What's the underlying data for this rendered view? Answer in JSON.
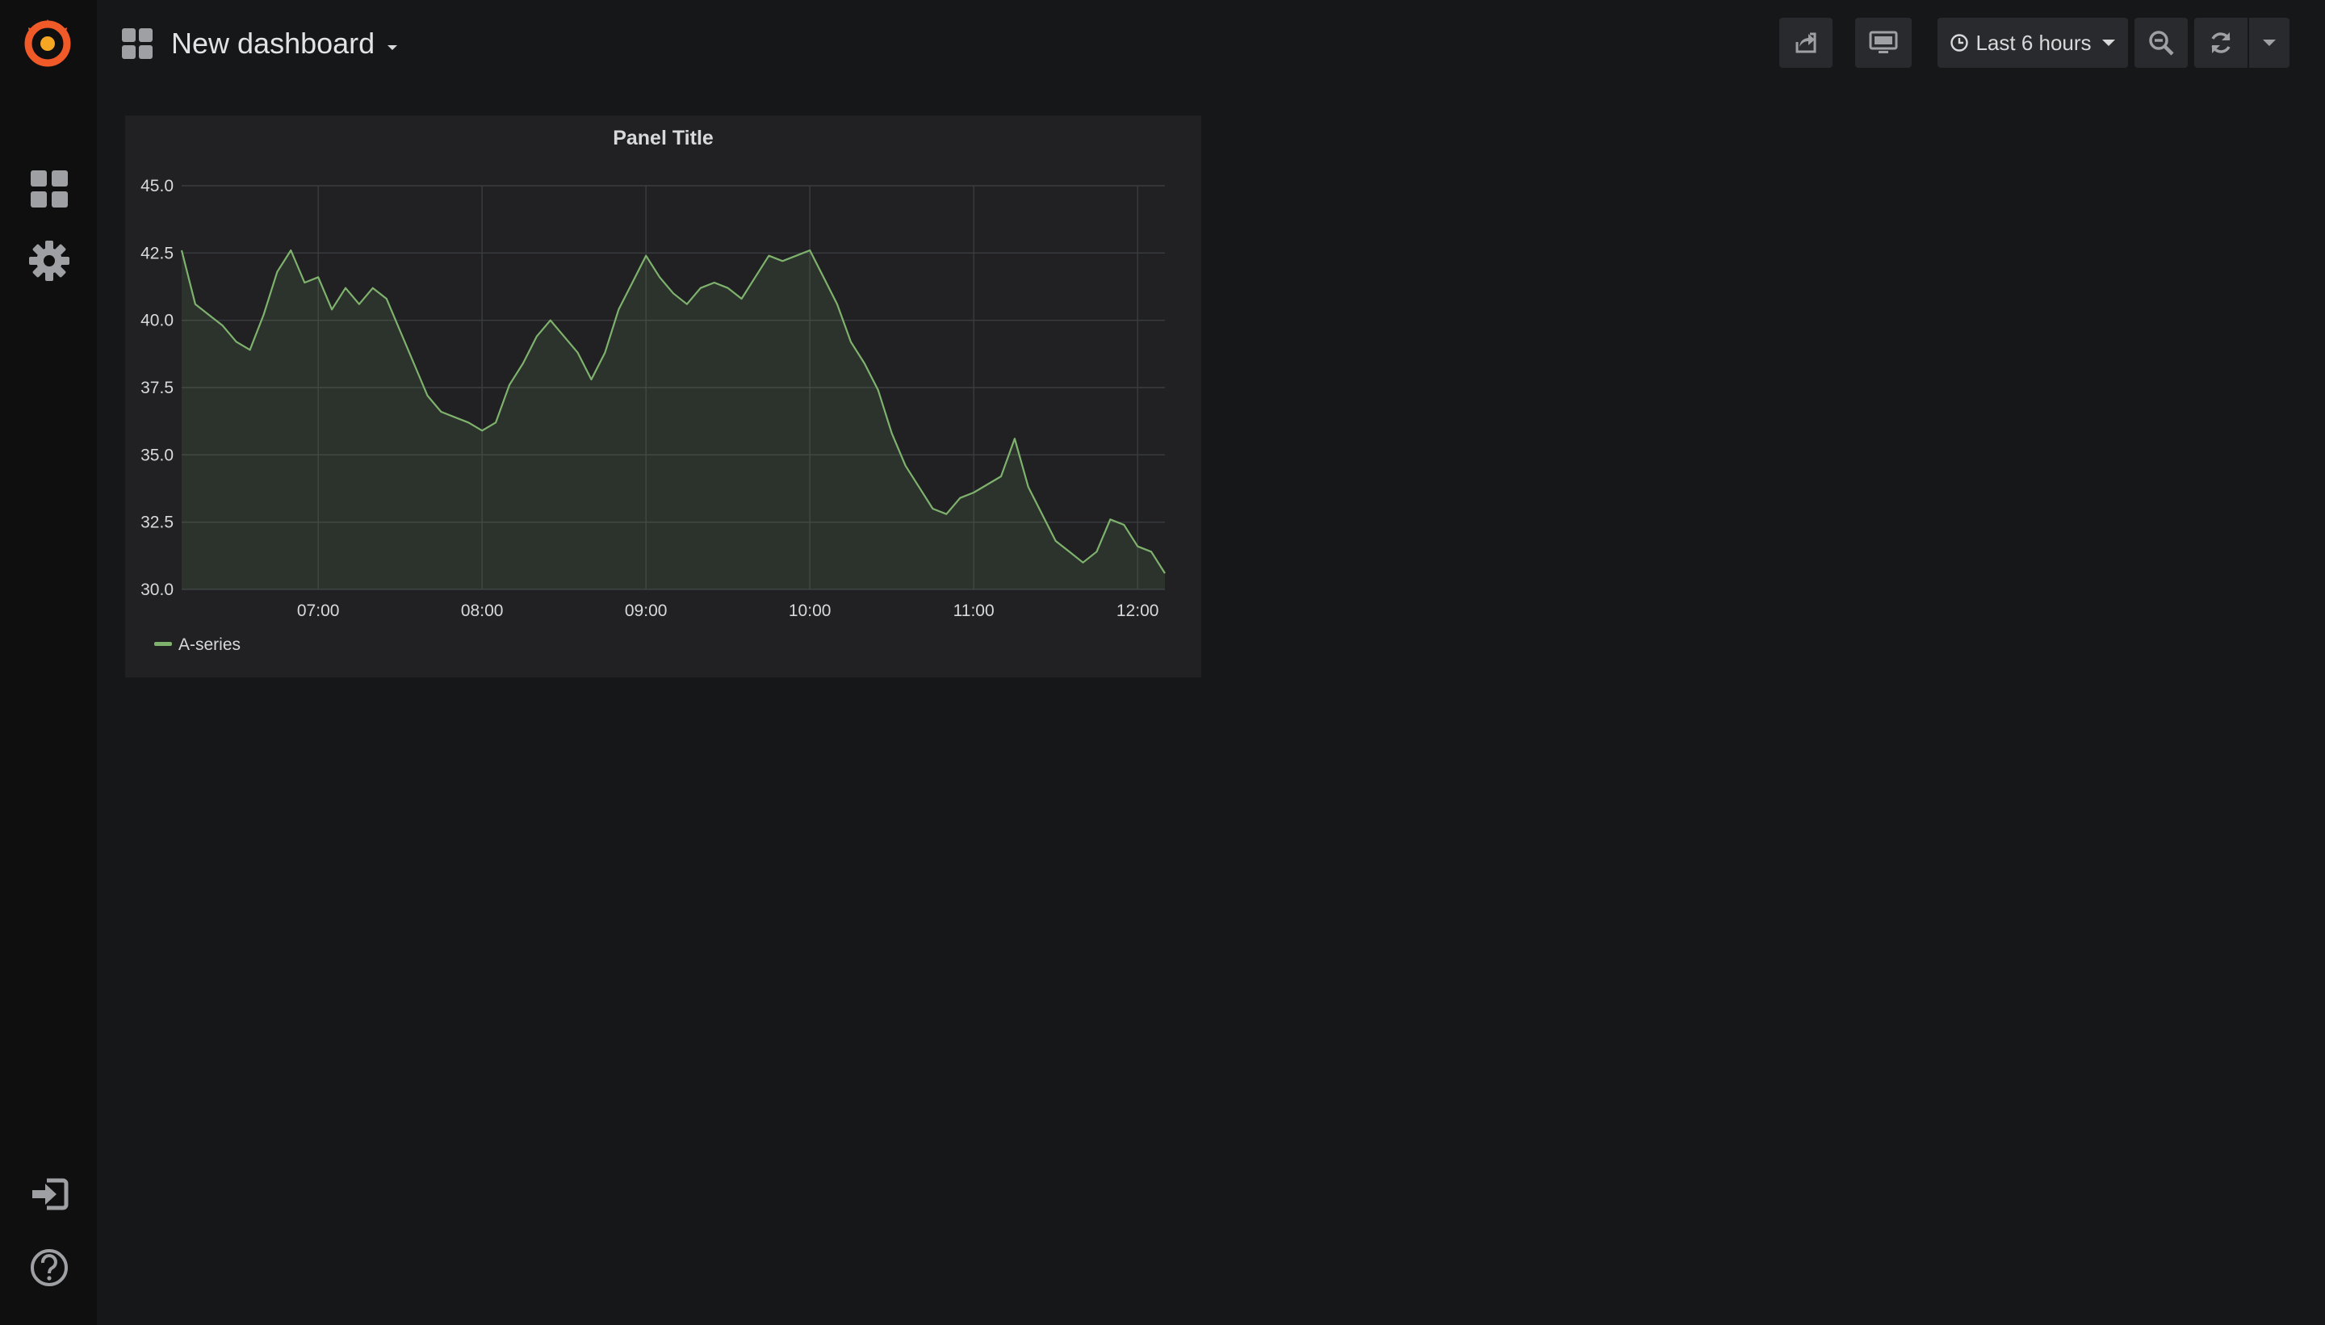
{
  "dashboard": {
    "title": "New dashboard"
  },
  "toolbar": {
    "time_range": "Last 6 hours"
  },
  "colors": {
    "background": "#161719",
    "sidebar": "#0f0f10",
    "panel": "#212124",
    "series": "#7eb26d",
    "logo": "#f05a28"
  },
  "icons": {
    "sidebar": [
      "grafana-logo-icon",
      "dashboards-icon",
      "gear-icon",
      "sign-in-icon",
      "help-icon"
    ],
    "toolbar": [
      "share-icon",
      "tv-mode-icon",
      "clock-icon",
      "caret-down-icon",
      "zoom-out-icon",
      "refresh-icon",
      "caret-down-icon"
    ]
  },
  "panel": {
    "title": "Panel Title"
  },
  "chart_data": {
    "type": "area",
    "title": "Panel Title",
    "xlabel": "",
    "ylabel": "",
    "y_ticks": [
      "30.0",
      "32.5",
      "35.0",
      "37.5",
      "40.0",
      "42.5",
      "45.0"
    ],
    "x_ticks": [
      "07:00",
      "08:00",
      "09:00",
      "10:00",
      "11:00",
      "12:00"
    ],
    "ylim": [
      30,
      45
    ],
    "xlim": [
      "06:10",
      "12:10"
    ],
    "grid": true,
    "legend_position": "bottom-left",
    "series": [
      {
        "name": "A-series",
        "color": "#7eb26d",
        "points": [
          [
            "06:10",
            42.6
          ],
          [
            "06:15",
            40.6
          ],
          [
            "06:20",
            40.2
          ],
          [
            "06:25",
            39.8
          ],
          [
            "06:30",
            39.2
          ],
          [
            "06:35",
            38.9
          ],
          [
            "06:40",
            40.2
          ],
          [
            "06:45",
            41.8
          ],
          [
            "06:50",
            42.6
          ],
          [
            "06:55",
            41.4
          ],
          [
            "07:00",
            41.6
          ],
          [
            "07:05",
            40.4
          ],
          [
            "07:10",
            41.2
          ],
          [
            "07:15",
            40.6
          ],
          [
            "07:20",
            41.2
          ],
          [
            "07:25",
            40.8
          ],
          [
            "07:30",
            39.6
          ],
          [
            "07:35",
            38.4
          ],
          [
            "07:40",
            37.2
          ],
          [
            "07:45",
            36.6
          ],
          [
            "07:50",
            36.4
          ],
          [
            "07:55",
            36.2
          ],
          [
            "08:00",
            35.9
          ],
          [
            "08:05",
            36.2
          ],
          [
            "08:10",
            37.6
          ],
          [
            "08:15",
            38.4
          ],
          [
            "08:20",
            39.4
          ],
          [
            "08:25",
            40.0
          ],
          [
            "08:30",
            39.4
          ],
          [
            "08:35",
            38.8
          ],
          [
            "08:40",
            37.8
          ],
          [
            "08:45",
            38.8
          ],
          [
            "08:50",
            40.4
          ],
          [
            "08:55",
            41.4
          ],
          [
            "09:00",
            42.4
          ],
          [
            "09:05",
            41.6
          ],
          [
            "09:10",
            41.0
          ],
          [
            "09:15",
            40.6
          ],
          [
            "09:20",
            41.2
          ],
          [
            "09:25",
            41.4
          ],
          [
            "09:30",
            41.2
          ],
          [
            "09:35",
            40.8
          ],
          [
            "09:40",
            41.6
          ],
          [
            "09:45",
            42.4
          ],
          [
            "09:50",
            42.2
          ],
          [
            "09:55",
            42.4
          ],
          [
            "10:00",
            42.6
          ],
          [
            "10:05",
            41.6
          ],
          [
            "10:10",
            40.6
          ],
          [
            "10:15",
            39.2
          ],
          [
            "10:20",
            38.4
          ],
          [
            "10:25",
            37.4
          ],
          [
            "10:30",
            35.8
          ],
          [
            "10:35",
            34.6
          ],
          [
            "10:40",
            33.8
          ],
          [
            "10:45",
            33.0
          ],
          [
            "10:50",
            32.8
          ],
          [
            "10:55",
            33.4
          ],
          [
            "11:00",
            33.6
          ],
          [
            "11:05",
            33.9
          ],
          [
            "11:10",
            34.2
          ],
          [
            "11:15",
            35.6
          ],
          [
            "11:20",
            33.8
          ],
          [
            "11:25",
            32.8
          ],
          [
            "11:30",
            31.8
          ],
          [
            "11:35",
            31.4
          ],
          [
            "11:40",
            31.0
          ],
          [
            "11:45",
            31.4
          ],
          [
            "11:50",
            32.6
          ],
          [
            "11:55",
            32.4
          ],
          [
            "12:00",
            31.6
          ],
          [
            "12:05",
            31.4
          ],
          [
            "12:10",
            30.6
          ]
        ]
      }
    ]
  }
}
